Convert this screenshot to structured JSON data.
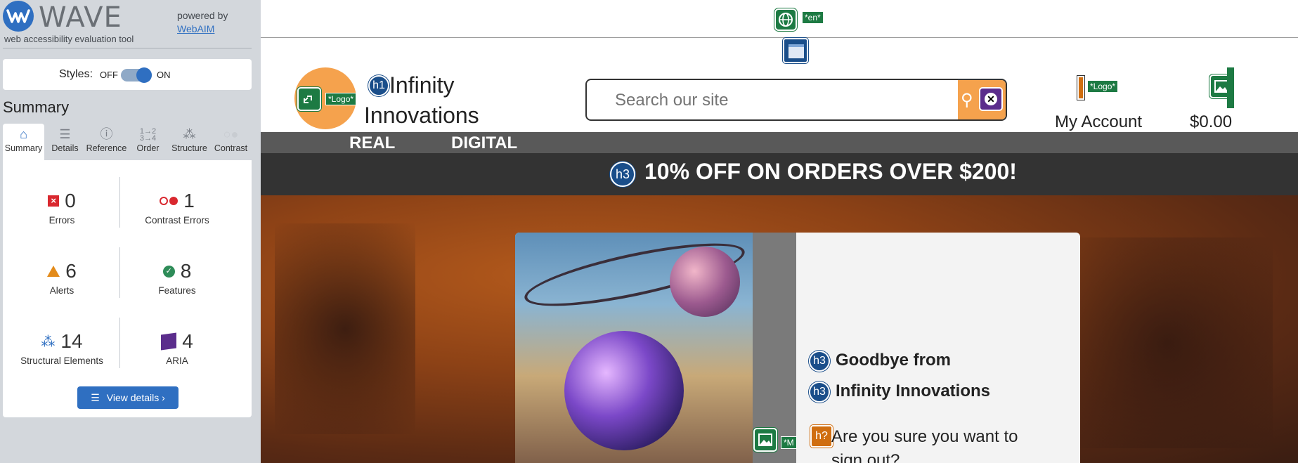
{
  "wave": {
    "title": "WAVE",
    "subtitle": "web accessibility evaluation tool",
    "powered_by": "powered by",
    "webaim_link": "WebAIM",
    "styles_label": "Styles:",
    "off_label": "OFF",
    "on_label": "ON",
    "summary_heading": "Summary",
    "tabs": [
      {
        "label": "Summary",
        "icon": "home-icon"
      },
      {
        "label": "Details",
        "icon": "list-icon"
      },
      {
        "label": "Reference",
        "icon": "info-icon"
      },
      {
        "label": "Order",
        "icon": "order-icon"
      },
      {
        "label": "Structure",
        "icon": "structure-icon"
      },
      {
        "label": "Contrast",
        "icon": "contrast-icon"
      }
    ],
    "stats": {
      "errors": {
        "count": "0",
        "label": "Errors"
      },
      "contrast": {
        "count": "1",
        "label": "Contrast Errors"
      },
      "alerts": {
        "count": "6",
        "label": "Alerts"
      },
      "features": {
        "count": "8",
        "label": "Features"
      },
      "structural": {
        "count": "14",
        "label": "Structural Elements"
      },
      "aria": {
        "count": "4",
        "label": "ARIA"
      }
    },
    "view_details": "View details ›"
  },
  "site": {
    "lang_tag": "*en*",
    "logo_tag": "*Logo*",
    "h1_badge": "h1",
    "brand_line1": "Infinity",
    "brand_line2": "Innovations",
    "search_placeholder": "Search our site",
    "account_logo_tag": "*Logo*",
    "account_label": "My Account",
    "cart_price": "$0.00",
    "nav": [
      "REAL",
      "DIGITAL"
    ],
    "promo_badge": "h3",
    "promo_text": "10% OFF ON ORDERS OVER $200!",
    "modal": {
      "h3_badge": "h3",
      "line1": "Goodbye from",
      "line2": "Infinity Innovations",
      "h_badge": "h?",
      "question": "Are you sure you want to sign out?",
      "img_tag": "*M"
    }
  },
  "colors": {
    "wave_blue": "#2f6fc1",
    "feature_green": "#1d7a43",
    "aria_purple": "#5b2d8c",
    "brand_orange": "#f5a24d",
    "nav_grey": "#595959",
    "promo_dark": "#333333"
  }
}
